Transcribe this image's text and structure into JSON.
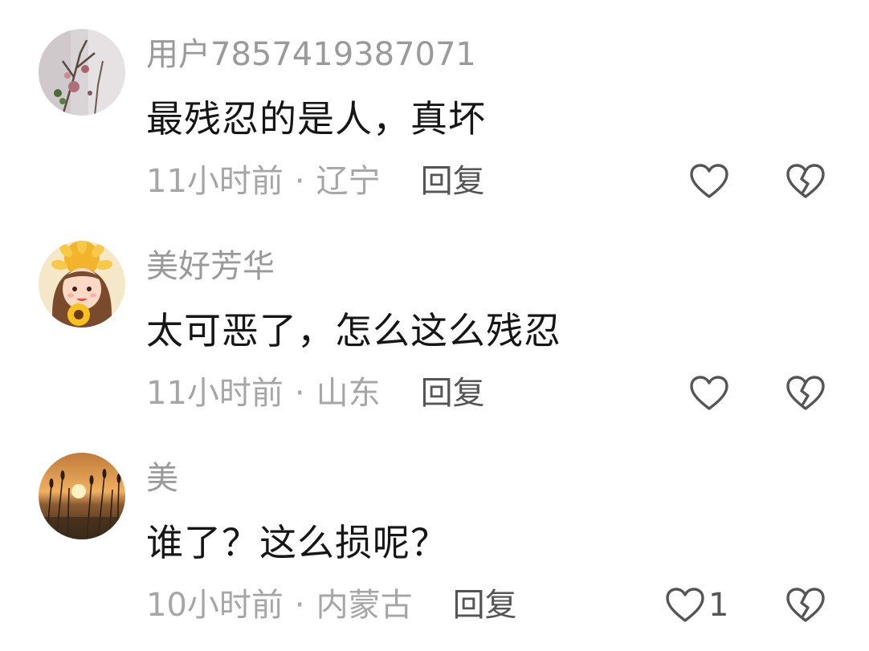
{
  "comments": [
    {
      "username": "用户7857419387071",
      "content": "最残忍的是人，真坏",
      "time": "11小时前",
      "separator": "·",
      "location": "辽宁",
      "reply_label": "回复",
      "like_count": "",
      "avatar_icon": "flower-branch-avatar"
    },
    {
      "username": "美好芳华",
      "content": "太可恶了，怎么这么残忍",
      "time": "11小时前",
      "separator": "·",
      "location": "山东",
      "reply_label": "回复",
      "like_count": "",
      "avatar_icon": "cartoon-girl-sunflower-avatar"
    },
    {
      "username": "美",
      "content": "谁了？这么损呢？",
      "time": "10小时前",
      "separator": "·",
      "location": "内蒙古",
      "reply_label": "回复",
      "like_count": "1",
      "avatar_icon": "sunset-field-avatar"
    }
  ],
  "colors": {
    "username": "#9a9a9a",
    "content": "#161616",
    "meta": "#a6a6a6",
    "reply": "#555555",
    "icon_stroke": "#555555"
  },
  "icons": {
    "like": "heart-outline-icon",
    "dislike": "broken-heart-icon"
  }
}
